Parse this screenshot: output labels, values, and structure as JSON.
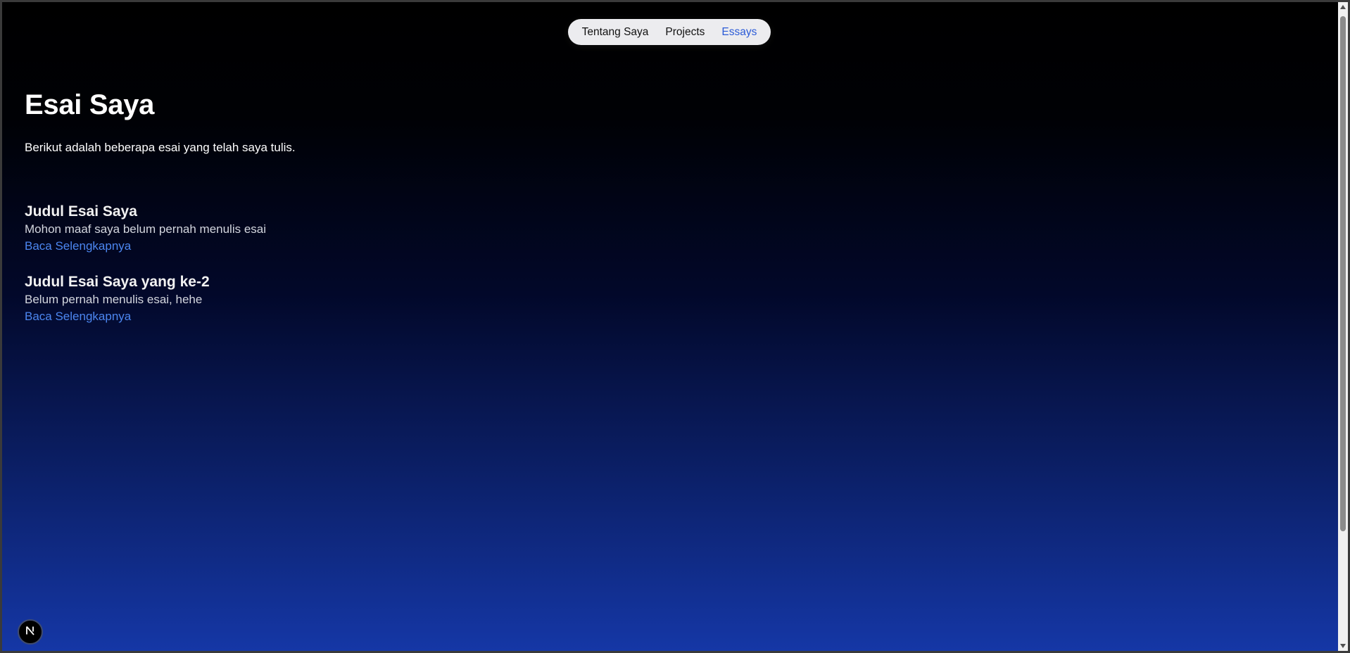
{
  "nav": {
    "items": [
      {
        "label": "Tentang Saya",
        "active": false
      },
      {
        "label": "Projects",
        "active": false
      },
      {
        "label": "Essays",
        "active": true
      }
    ],
    "active_color": "#2b5bd7"
  },
  "main": {
    "title": "Esai Saya",
    "intro": "Berikut adalah beberapa esai yang telah saya tulis.",
    "essays": [
      {
        "title": "Judul Esai Saya",
        "description": "Mohon maaf saya belum pernah menulis esai",
        "link_label": "Baca Selengkapnya"
      },
      {
        "title": "Judul Esai Saya yang ke-2",
        "description": "Belum pernah menulis esai, hehe",
        "link_label": "Baca Selengkapnya"
      }
    ]
  },
  "dev_indicator": {
    "icon": "nextjs-logo-icon"
  },
  "colors": {
    "gradient_top": "#000000",
    "gradient_bottom": "#1537a6",
    "link": "#4c86f0"
  }
}
